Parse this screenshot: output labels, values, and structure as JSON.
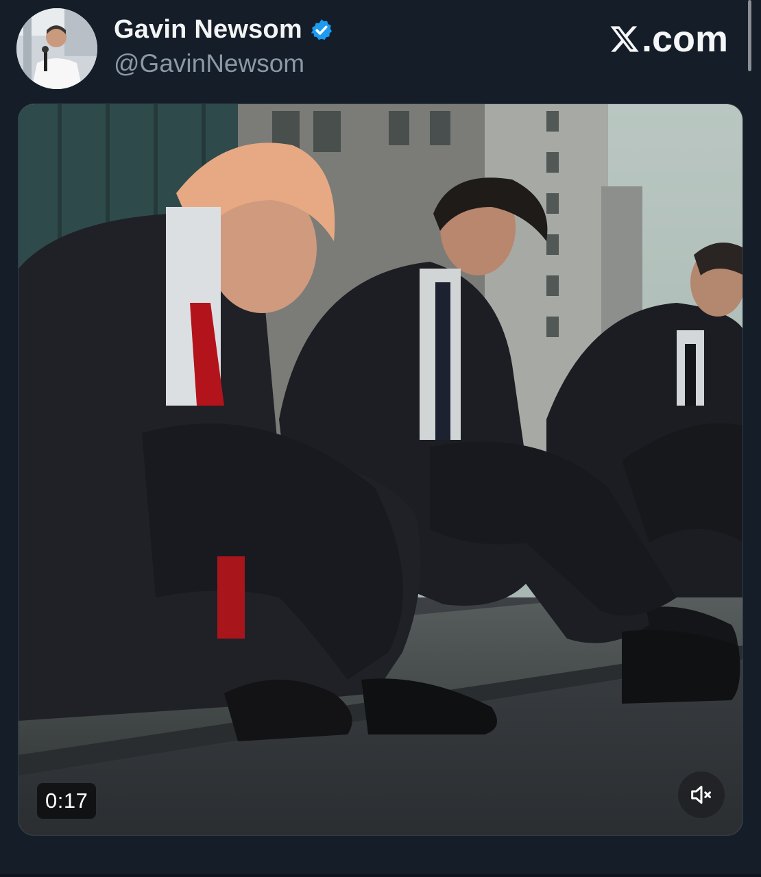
{
  "author": {
    "display_name": "Gavin Newsom",
    "handle": "@GavinNewsom",
    "verified": true,
    "avatar_icon": "profile-photo"
  },
  "site": {
    "label": ".com",
    "logo_icon": "x-logo-icon"
  },
  "video": {
    "timestamp": "0:17",
    "mute_icon": "speaker-muted-icon",
    "description_icon": "video-frame"
  },
  "colors": {
    "background": "#151d28",
    "verified_badge": "#1d9bf0",
    "handle_text": "#8b98a5"
  }
}
